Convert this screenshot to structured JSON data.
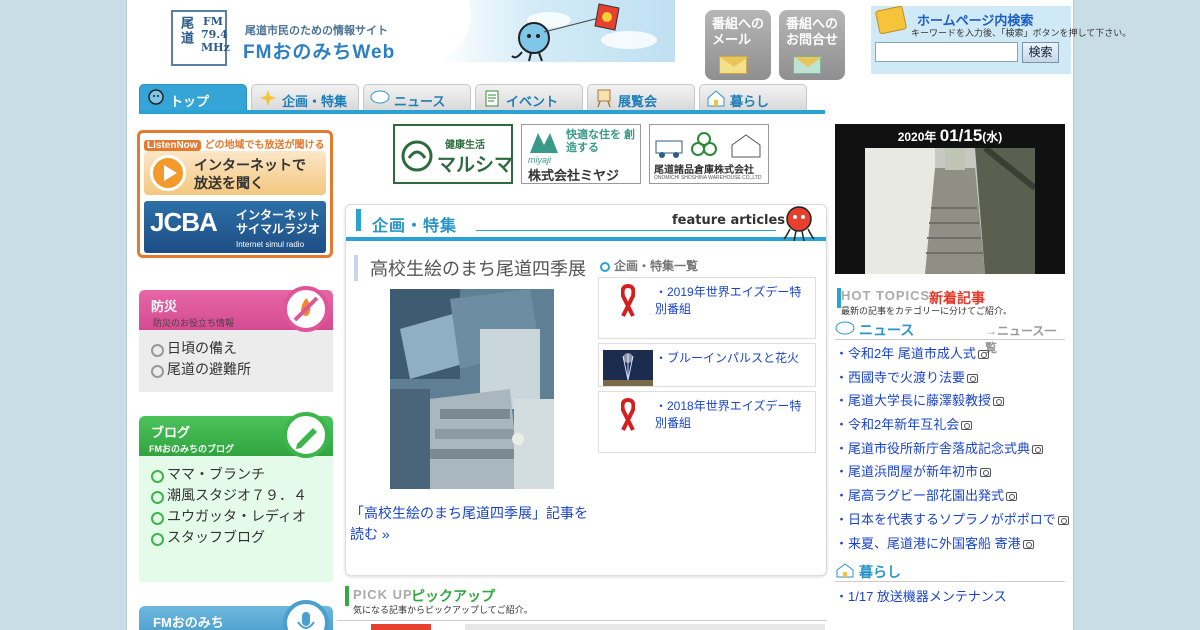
{
  "header": {
    "logo_kanji": "尾道",
    "logo_freq": "FM 79.4 MHz",
    "tagline": "尾道市民のための情報サイト",
    "site_name": "FMおのみちWeb",
    "mail_button": "番組への メール",
    "contact_button": "番組への お問合せ",
    "search_title": "ホームページ内検索",
    "search_note": "キーワードを入力後、「検索」ボタンを押して下さい。",
    "search_value": "",
    "search_button": "検索"
  },
  "nav": {
    "tabs": [
      {
        "label": "トップ",
        "active": true
      },
      {
        "label": "企画・特集",
        "active": false
      },
      {
        "label": "ニュース",
        "active": false
      },
      {
        "label": "イベント",
        "active": false
      },
      {
        "label": "展覧会",
        "active": false
      },
      {
        "label": "暮らし",
        "active": false
      }
    ]
  },
  "listen": {
    "badge": "ListenNow",
    "headline": "どの地域でも放送が聞ける",
    "main_line1": "インターネットで",
    "main_line2": "放送を聞く",
    "jcba_logo": "JCBA",
    "jcba_line1": "インターネット",
    "jcba_line2": "サイマルラジオ",
    "jcba_line3": "Internet simul radio"
  },
  "bousai": {
    "title": "防災",
    "subtitle": "防災のお役立ち情報",
    "items": [
      "日頃の備え",
      "尾道の避難所"
    ]
  },
  "blog": {
    "title": "ブログ",
    "subtitle": "FMおのみちのブログ",
    "items": [
      "ママ・ブランチ",
      "潮風スタジオ７９．４",
      "ユウガッタ・レディオ",
      "スタッフブログ"
    ]
  },
  "fm_section": {
    "title": "FMおのみち"
  },
  "sponsors": [
    {
      "top": "健康生活",
      "name": "マルシマ"
    },
    {
      "top": "快適な住を 創造する",
      "name": "株式会社ミヤジ",
      "brand": "miyaji"
    },
    {
      "name": "尾道諸品倉庫株式会社",
      "sub": "ONOMICHI SHOSHINA WAREHOUSE CO.,LTD"
    }
  ],
  "feature": {
    "title": "企画・特集",
    "title_en": "feature articles",
    "article_title": "高校生絵のまち尾道四季展",
    "article_link": "「高校生絵のまち尾道四季展」記事を読む »",
    "list_title": "企画・特集一覧",
    "list": [
      {
        "text": "・2019年世界エイズデー特別番組",
        "thumb": "red-ribbon-icon"
      },
      {
        "text": "・ブルーインパルスと花火",
        "thumb": "fireworks-photo"
      },
      {
        "text": "・2018年世界エイズデー特別番組",
        "thumb": "red-ribbon-icon"
      }
    ]
  },
  "pickup": {
    "title_en": "PICK UP",
    "title": "ピックアップ",
    "subtitle": "気になる記事からピックアップしてご紹介。"
  },
  "date": {
    "year": "2020年",
    "day": "01/15",
    "weekday": "(水)"
  },
  "hot_topics": {
    "title_en": "HOT TOPICS",
    "title": "新着記事",
    "subtitle": "最新の記事をカテゴリーに分けてご紹介。"
  },
  "news": {
    "title": "ニュース",
    "all_link": "→ニュース一覧",
    "items": [
      "・令和2年 尾道市成人式",
      "・西國寺で火渡り法要",
      "・尾道大学長に藤澤毅教授",
      "・令和2年新年互礼会",
      "・尾道市役所新庁舎落成記念式典",
      "・尾道浜問屋が新年初市",
      "・尾高ラグビー部花園出発式",
      "・日本を代表するソプラノがポポロで",
      "・来夏、尾道港に外国客船 寄港"
    ]
  },
  "kurashi": {
    "title": "暮らし",
    "items": [
      "・1/17 放送機器メンテナンス"
    ]
  },
  "colors": {
    "accent_blue": "#2aa2d4",
    "listen_orange": "#e47a2e",
    "bousai_pink": "#e0559a",
    "blog_green": "#3cb54a",
    "link_blue": "#1a44c8"
  }
}
